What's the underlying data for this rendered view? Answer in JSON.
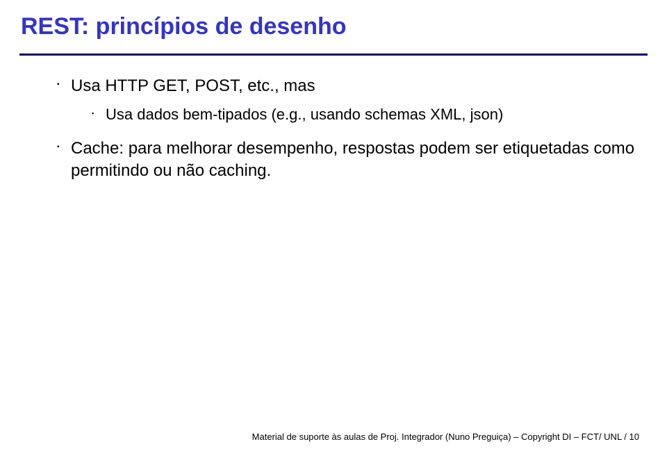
{
  "title": "REST: princípios de desenho",
  "bullets": {
    "b1": "Usa HTTP GET, POST, etc., mas",
    "b1a": "Usa dados bem-tipados (e.g., usando schemas XML, json)",
    "b2": "Cache: para melhorar desempenho, respostas podem ser etiquetadas como permitindo ou não caching."
  },
  "footer": "Material de suporte às aulas de Proj. Integrador (Nuno Preguiça) – Copyright DI – FCT/ UNL  /   10"
}
